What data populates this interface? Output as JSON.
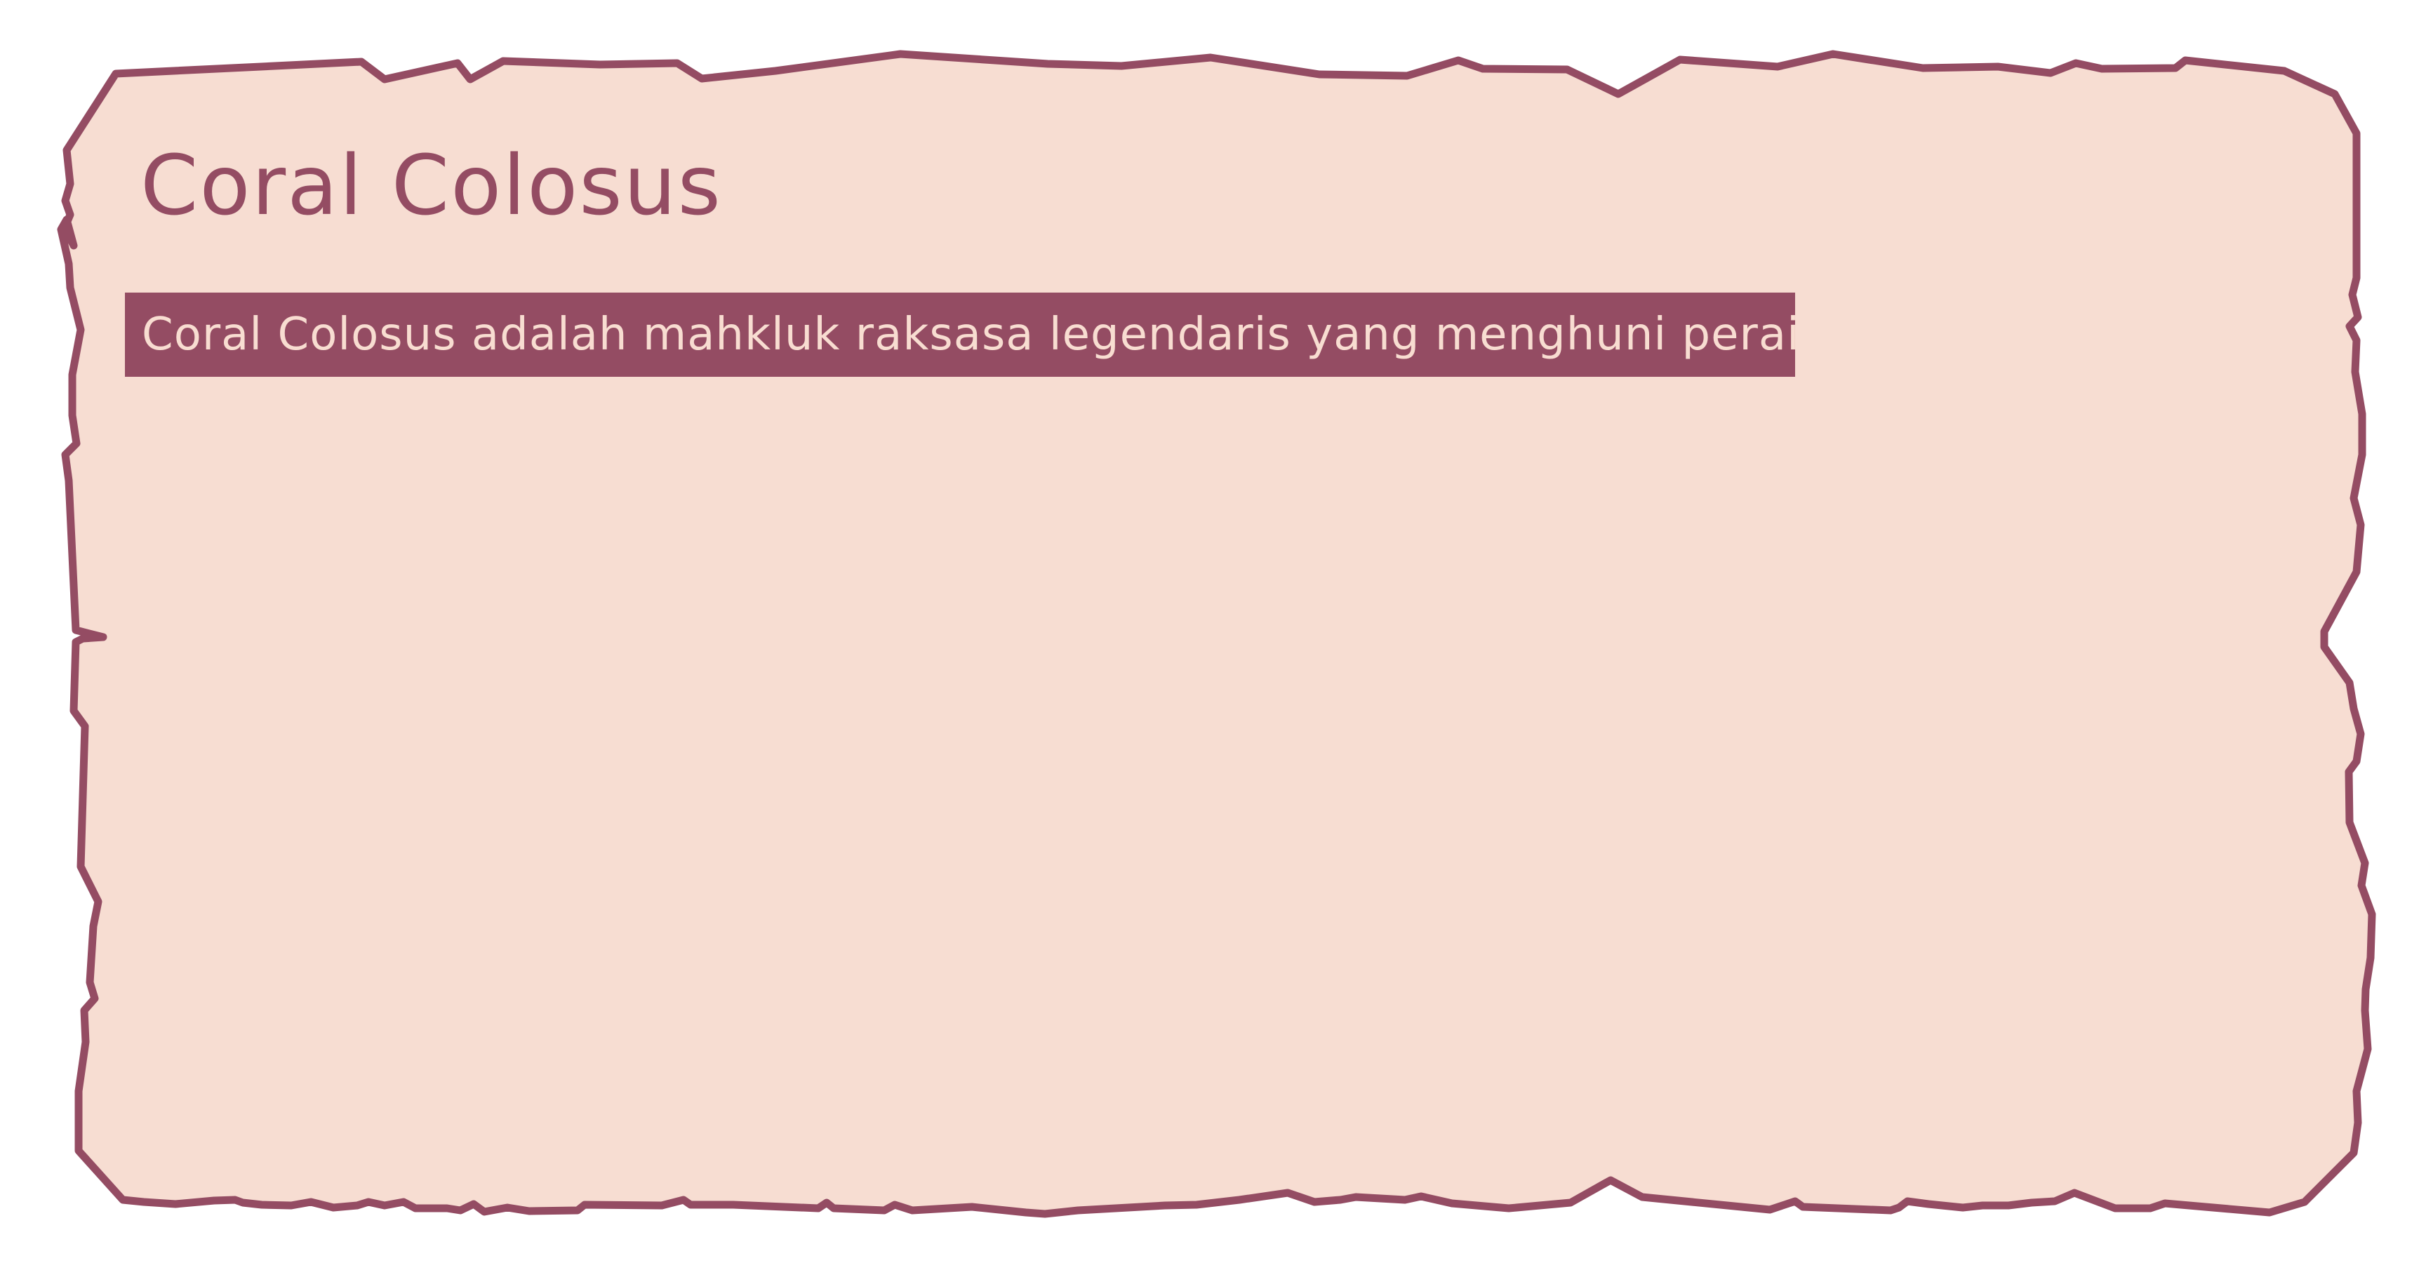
{
  "card": {
    "title": "Coral Colosus",
    "description": "Coral Colosus adalah mahkluk raksasa legendaris yang menghuni perairan."
  },
  "colors": {
    "background": "#ffffff",
    "card_fill": "#f7ddd2",
    "card_border": "#944c63",
    "title_text": "#944c63",
    "description_bg": "#944c63",
    "description_text": "#f8ddd1"
  }
}
